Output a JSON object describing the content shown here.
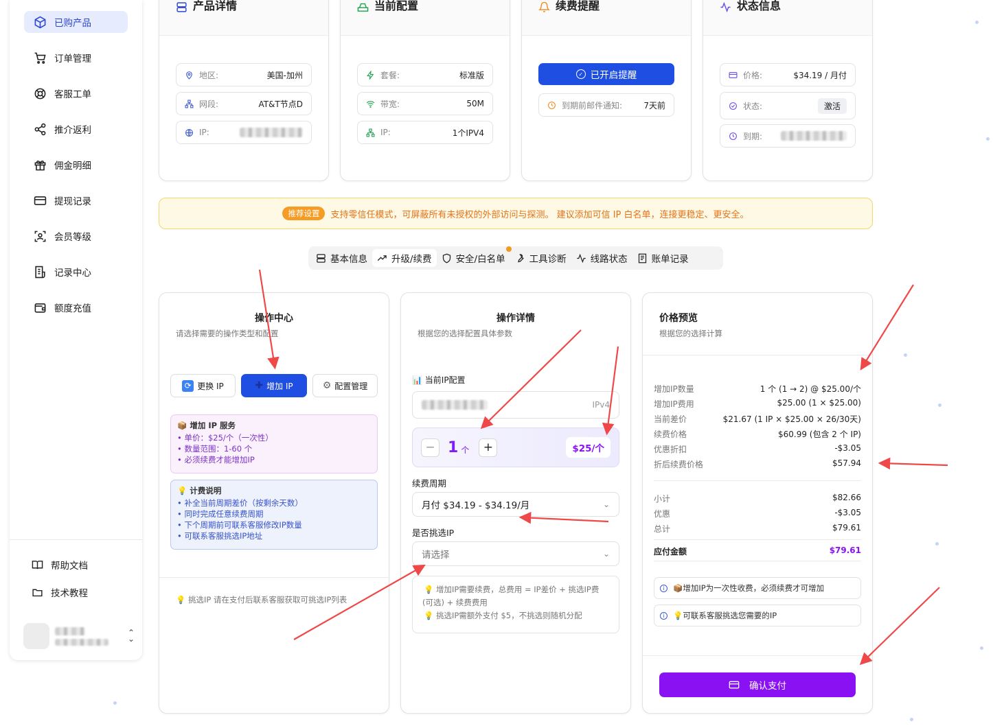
{
  "sidebar": {
    "items": [
      {
        "label": "已购产品",
        "icon": "package-icon",
        "active": true
      },
      {
        "label": "订单管理",
        "icon": "cart-icon"
      },
      {
        "label": "客服工单",
        "icon": "lifebuoy-icon"
      },
      {
        "label": "推介返利",
        "icon": "share-icon"
      },
      {
        "label": "佣金明细",
        "icon": "gift-icon"
      },
      {
        "label": "提现记录",
        "icon": "card-icon"
      },
      {
        "label": "会员等级",
        "icon": "scan-icon"
      },
      {
        "label": "记录中心",
        "icon": "receipt-icon"
      },
      {
        "label": "额度充值",
        "icon": "wallet-icon"
      }
    ],
    "bottom": [
      {
        "label": "帮助文档",
        "icon": "book-icon"
      },
      {
        "label": "技术教程",
        "icon": "folder-icon"
      }
    ]
  },
  "product": {
    "title": "产品详情",
    "region_label": "地区:",
    "region": "美国-加州",
    "segment_label": "网段:",
    "segment": "AT&T节点D",
    "ip_label": "IP:"
  },
  "config": {
    "title": "当前配置",
    "plan_label": "套餐:",
    "plan": "标准版",
    "bandwidth_label": "带宽:",
    "bandwidth": "50M",
    "ip_label": "IP:",
    "ip": "1个IPV4"
  },
  "renewal": {
    "title": "续费提醒",
    "button": "已开启提醒",
    "notify_label": "到期前邮件通知:",
    "notify": "7天前"
  },
  "status": {
    "title": "状态信息",
    "price_label": "价格:",
    "price": "$34.19 / 月付",
    "state_label": "状态:",
    "state": "激活",
    "expire_label": "到期:"
  },
  "banner": {
    "tag": "推荐设置",
    "text": "支持零信任模式，可屏蔽所有未授权的外部访问与探测。 建议添加可信 IP 白名单，连接更稳定、更安全。"
  },
  "tabs": [
    {
      "label": "基本信息",
      "icon": "server-icon"
    },
    {
      "label": "升级/续费",
      "icon": "trending-up-icon",
      "active": true
    },
    {
      "label": "安全/白名单",
      "icon": "shield-icon",
      "notify": true
    },
    {
      "label": "工具诊断",
      "icon": "wrench-icon"
    },
    {
      "label": "线路状态",
      "icon": "activity-icon"
    },
    {
      "label": "账单记录",
      "icon": "receipt-icon"
    }
  ],
  "ops": {
    "title": "操作中心",
    "subtitle": "请选择需要的操作类型和配置",
    "buttons": [
      {
        "label": "更换 IP",
        "icon": "refresh-icon"
      },
      {
        "label": "增加 IP",
        "icon": "plus-icon",
        "active": true
      },
      {
        "label": "配置管理",
        "icon": "gear-icon"
      }
    ],
    "service": {
      "title": "增加 IP 服务",
      "lines": [
        "• 单价：$25/个（一次性）",
        "• 数量范围：1-60 个",
        "• 必须续费才能增加IP"
      ]
    },
    "billing": {
      "title": "计费说明",
      "lines": [
        "• 补全当前周期差价（按剩余天数）",
        "• 同时完成任意续费周期",
        "• 下个周期前可联系客服修改IP数量",
        "• 可联系客服挑选IP地址"
      ]
    },
    "note": "挑选IP 请在支付后联系客服获取可挑选IP列表"
  },
  "detail": {
    "title": "操作详情",
    "subtitle": "根据您的选择配置具体参数",
    "current_label": "当前IP配置",
    "ip_type": "IPv4",
    "quantity": "1",
    "unit": "个",
    "unit_price": "$25/个",
    "period_label": "续费周期",
    "period_value": "月付 $34.19 - $34.19/月",
    "select_label": "是否挑选IP",
    "select_placeholder": "请选择",
    "tips": [
      "增加IP需要续费，总费用 = IP差价 + 挑选IP费",
      "(可选) + 续费费用",
      "挑选IP需额外支付 $5，不挑选则随机分配"
    ]
  },
  "preview": {
    "title": "价格预览",
    "subtitle": "根据您的选择计算",
    "rows": [
      {
        "k": "增加IP数量",
        "v": "1 个 (1 → 2) @ $25.00/个"
      },
      {
        "k": "增加IP费用",
        "v": "$25.00 (1 × $25.00)"
      },
      {
        "k": "当前差价",
        "v": "$21.67 (1 IP × $25.00 × 26/30天)"
      },
      {
        "k": "续费价格",
        "v": "$60.99 (包含 2 个 IP)"
      },
      {
        "k": "优惠折扣",
        "v": "-$3.05"
      },
      {
        "k": "折后续费价格",
        "v": "$57.94"
      }
    ],
    "summary": [
      {
        "k": "小计",
        "v": "$82.66"
      },
      {
        "k": "优惠",
        "v": "-$3.05"
      },
      {
        "k": "总计",
        "v": "$79.61"
      }
    ],
    "total_label": "应付金额",
    "total": "$79.61",
    "notes": [
      "增加IP为一次性收费，必须续费才可增加",
      "可联系客服挑选您需要的IP"
    ],
    "pay_button": "确认支付"
  },
  "colors": {
    "primary": "#1f4ee3",
    "purple": "#8a12f2",
    "orange": "#e3731b",
    "arrow": "#ee4848"
  }
}
